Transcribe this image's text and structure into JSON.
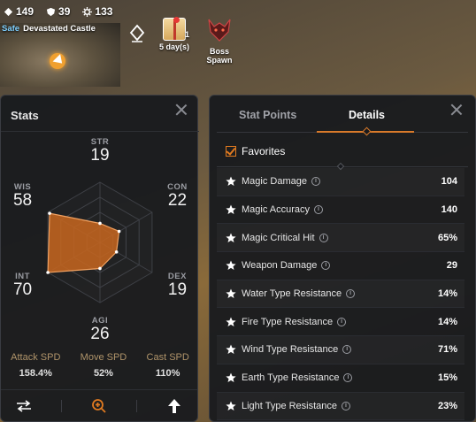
{
  "hud": {
    "stats": [
      {
        "icon": "level-icon",
        "value": "149"
      },
      {
        "icon": "shield-icon",
        "value": "39"
      },
      {
        "icon": "gear-icon",
        "value": "133"
      }
    ],
    "zone": {
      "status": "Safe",
      "name": "Devastated Castle"
    },
    "gift": {
      "count": "1",
      "label": "5 day(s)"
    },
    "boss": {
      "label": "Boss Spawn"
    }
  },
  "stats_panel": {
    "title": "Stats",
    "radar": {
      "max": 60,
      "stats": [
        {
          "key": "STR",
          "value": 19
        },
        {
          "key": "CON",
          "value": 22
        },
        {
          "key": "DEX",
          "value": 19
        },
        {
          "key": "AGI",
          "value": 26
        },
        {
          "key": "INT",
          "value": 70
        },
        {
          "key": "WIS",
          "value": 58
        }
      ]
    },
    "speeds": [
      {
        "label": "Attack SPD",
        "value": "158.4%"
      },
      {
        "label": "Move SPD",
        "value": "52%"
      },
      {
        "label": "Cast SPD",
        "value": "110%"
      }
    ],
    "footer_icons": [
      "swap-icon",
      "zoom-in-icon",
      "arrow-up-icon"
    ]
  },
  "details_panel": {
    "tabs": [
      "Stat Points",
      "Details"
    ],
    "active_tab": "Details",
    "favorites_label": "Favorites",
    "rows": [
      {
        "label": "Magic Damage",
        "value": "104"
      },
      {
        "label": "Magic Accuracy",
        "value": "140"
      },
      {
        "label": "Magic Critical Hit",
        "value": "65%"
      },
      {
        "label": "Weapon Damage",
        "value": "29"
      },
      {
        "label": "Water Type Resistance",
        "value": "14%"
      },
      {
        "label": "Fire Type Resistance",
        "value": "14%"
      },
      {
        "label": "Wind Type Resistance",
        "value": "71%"
      },
      {
        "label": "Earth Type Resistance",
        "value": "15%"
      },
      {
        "label": "Light Type Resistance",
        "value": "23%"
      }
    ]
  },
  "colors": {
    "accent": "#e07a20",
    "panel_bg": "#181a1e",
    "radar_fill": "#c8661e"
  }
}
